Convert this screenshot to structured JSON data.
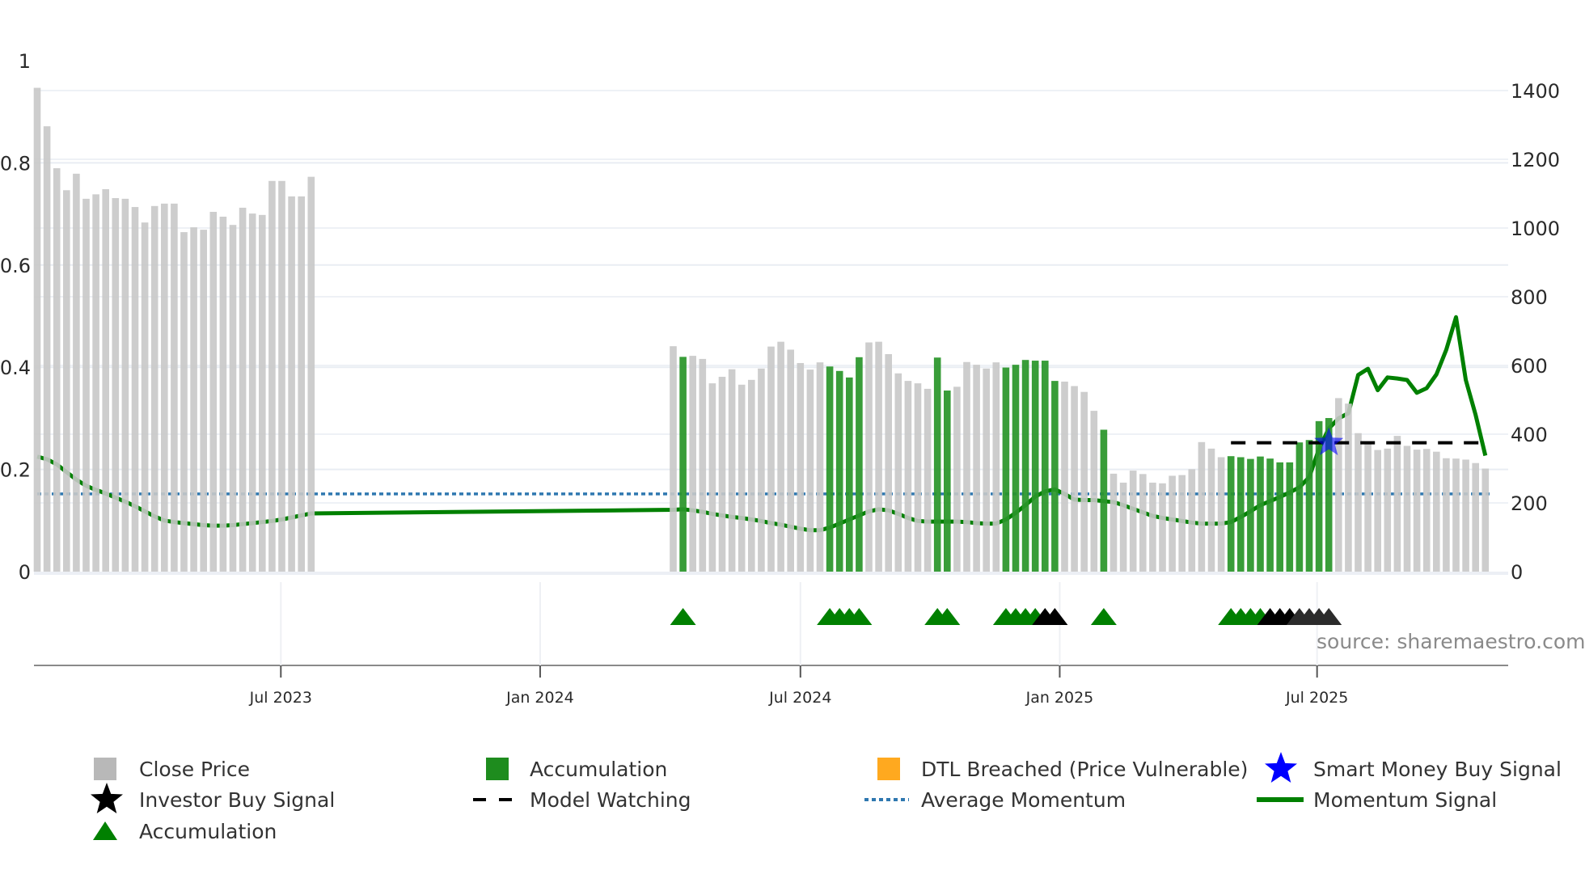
{
  "chart_data": {
    "type": "bar",
    "interval": "weekly",
    "left_axis": {
      "label": "",
      "ylim": [
        0,
        1
      ],
      "ticks": [
        "0",
        "0.2",
        "0.4",
        "0.6",
        "0.8",
        "1"
      ],
      "tick_values": [
        0,
        0.2,
        0.4,
        0.6,
        0.8,
        1
      ]
    },
    "right_axis": {
      "label": "",
      "ylim": [
        0,
        1400
      ],
      "ticks": [
        "0",
        "200",
        "400",
        "600",
        "800",
        "1000",
        "1200",
        "1400"
      ],
      "tick_values": [
        0,
        200,
        400,
        600,
        800,
        1000,
        1200,
        1400
      ]
    },
    "x_ticks": [
      {
        "label": "Jul 2023",
        "week_index": 24.9
      },
      {
        "label": "Jan 2024",
        "week_index": 51.4
      },
      {
        "label": "Jul 2024",
        "week_index": 78.0
      },
      {
        "label": "Jan 2025",
        "week_index": 104.5
      },
      {
        "label": "Jul 2025",
        "week_index": 130.8
      }
    ],
    "close_price": [
      1408,
      1296,
      1174,
      1110,
      1158,
      1085,
      1098,
      1113,
      1087,
      1085,
      1061,
      1016,
      1064,
      1071,
      1071,
      988,
      1002,
      995,
      1047,
      1033,
      1009,
      1059,
      1042,
      1038,
      1137,
      1137,
      1092,
      1092,
      1149,
      null,
      null,
      null,
      null,
      null,
      null,
      null,
      null,
      null,
      null,
      null,
      null,
      null,
      null,
      null,
      null,
      null,
      null,
      null,
      null,
      null,
      null,
      null,
      null,
      null,
      null,
      null,
      null,
      null,
      null,
      null,
      null,
      null,
      null,
      null,
      null,
      656,
      625,
      628,
      619,
      548,
      567,
      589,
      544,
      558,
      591,
      655,
      669,
      646,
      607,
      588,
      609,
      597,
      584,
      565,
      624,
      667,
      669,
      633,
      577,
      555,
      548,
      532,
      623,
      527,
      538,
      610,
      602,
      591,
      609,
      594,
      602,
      616,
      614,
      614,
      555,
      553,
      540,
      523,
      468,
      413,
      285,
      259,
      294,
      284,
      259,
      257,
      279,
      281,
      298,
      377,
      358,
      333,
      336,
      333,
      328,
      335,
      329,
      318,
      318,
      376,
      383,
      438,
      447,
      505,
      489,
      403,
      379,
      354,
      358,
      395,
      366,
      355,
      357,
      349,
      330,
      329,
      326,
      316,
      300
    ],
    "accumulation_bar_weeks": [
      66,
      81,
      82,
      83,
      84,
      92,
      93,
      99,
      100,
      101,
      102,
      103,
      104,
      109,
      122,
      123,
      124,
      125,
      126,
      127,
      128,
      129,
      130,
      131,
      132
    ],
    "momentum_signal": [
      0.225,
      0.22,
      0.21,
      0.195,
      0.18,
      0.168,
      0.16,
      0.153,
      0.145,
      0.137,
      0.128,
      0.118,
      0.108,
      0.1,
      0.097,
      0.095,
      0.093,
      0.091,
      0.09,
      0.09,
      0.091,
      0.093,
      0.095,
      0.097,
      0.099,
      0.102,
      0.106,
      0.11,
      0.114,
      null,
      null,
      null,
      null,
      null,
      null,
      null,
      null,
      null,
      null,
      null,
      null,
      null,
      null,
      null,
      null,
      null,
      null,
      null,
      null,
      null,
      null,
      null,
      null,
      null,
      null,
      null,
      null,
      null,
      null,
      null,
      null,
      null,
      null,
      null,
      null,
      0.121,
      0.122,
      0.12,
      0.117,
      0.113,
      0.11,
      0.107,
      0.105,
      0.102,
      0.099,
      0.095,
      0.092,
      0.088,
      0.084,
      0.081,
      0.081,
      0.086,
      0.094,
      0.102,
      0.11,
      0.118,
      0.122,
      0.12,
      0.113,
      0.105,
      0.099,
      0.098,
      0.098,
      0.098,
      0.098,
      0.097,
      0.095,
      0.094,
      0.094,
      0.102,
      0.115,
      0.13,
      0.147,
      0.157,
      0.161,
      0.152,
      0.141,
      0.14,
      0.14,
      0.138,
      0.136,
      0.13,
      0.123,
      0.116,
      0.109,
      0.105,
      0.102,
      0.099,
      0.096,
      0.094,
      0.094,
      0.094,
      0.097,
      0.107,
      0.118,
      0.13,
      0.138,
      0.146,
      0.155,
      0.165,
      0.185,
      0.24,
      0.28,
      0.3,
      0.31,
      0.385,
      0.397,
      0.355,
      0.38,
      0.378,
      0.375,
      0.35,
      0.359,
      0.386,
      0.434,
      0.498,
      0.375,
      0.307,
      0.227
    ],
    "average_momentum": 0.152,
    "model_watching": {
      "price": 375,
      "from_week": 122,
      "to_week": 148
    },
    "smart_money_buy": [
      {
        "week": 132,
        "price": 375
      }
    ],
    "accumulation_triangles": [
      66,
      81,
      82,
      83,
      84,
      92,
      93,
      99,
      100,
      101,
      102,
      109,
      122,
      123,
      124,
      125
    ],
    "investor_buy_triangles": [
      103,
      104,
      126,
      127,
      128
    ],
    "investor_buy_triangles_dark": [
      129,
      130,
      131,
      132
    ],
    "colors": {
      "close_price": "#c8c8c8",
      "accumulation": "#2a962a",
      "dtl": "#ffa91f",
      "smart_money": "#0000ff",
      "investor": "#000000",
      "model_watching": "#000000",
      "avg_momentum": "#2f78b0",
      "momentum": "#008000"
    },
    "legend": [
      {
        "label": "Close Price",
        "marker": "square",
        "color": "#b8b8b8"
      },
      {
        "label": "Accumulation",
        "marker": "square",
        "color": "#1e8c1e"
      },
      {
        "label": "DTL Breached (Price Vulnerable)",
        "marker": "square",
        "color": "#ffa91f"
      },
      {
        "label": "Smart Money Buy Signal",
        "marker": "star",
        "color": "#0000ff"
      },
      {
        "label": "Investor Buy Signal",
        "marker": "star",
        "color": "#000000"
      },
      {
        "label": "Model Watching",
        "marker": "dash",
        "color": "#000000"
      },
      {
        "label": "Average Momentum",
        "marker": "dot",
        "color": "#2f78b0"
      },
      {
        "label": "Momentum Signal",
        "marker": "line",
        "color": "#008000"
      },
      {
        "label": "Accumulation",
        "marker": "triangle",
        "color": "#008000"
      }
    ],
    "source": "source: sharemaestro.com"
  }
}
